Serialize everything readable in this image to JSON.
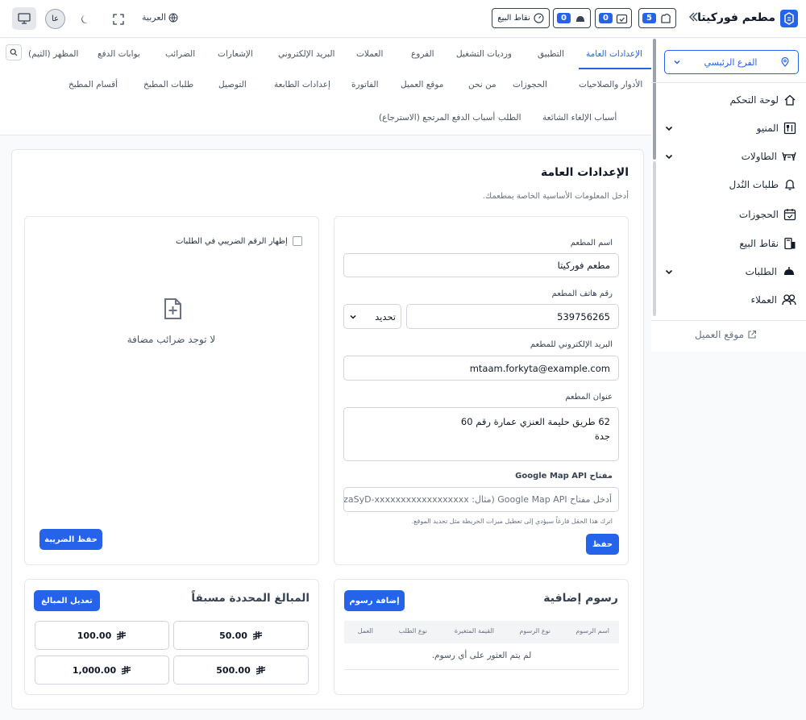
{
  "header": {
    "brand": "مطعم فوركيتا",
    "pos_label": "نقاط البيع",
    "counters": [
      {
        "name": "orders",
        "value": "5"
      },
      {
        "name": "reservations",
        "value": "0"
      },
      {
        "name": "waiter-calls",
        "value": "0"
      },
      {
        "name": "service",
        "value": "0"
      }
    ],
    "language": "العربية",
    "avatar_initials": "عا"
  },
  "sidebar": {
    "branch": "الفرع الرئيسي",
    "items": [
      {
        "label": "لوحة التحكم",
        "icon": "home-icon",
        "has_children": false
      },
      {
        "label": "المنيو",
        "icon": "menu-icon",
        "has_children": true
      },
      {
        "label": "الطاولات",
        "icon": "table-icon",
        "has_children": true
      },
      {
        "label": "طلبات النُدل",
        "icon": "bell-icon",
        "has_children": false
      },
      {
        "label": "الحجوزات",
        "icon": "calendar-icon",
        "has_children": false
      },
      {
        "label": "نقاط البيع",
        "icon": "pos-icon",
        "has_children": false
      },
      {
        "label": "الطلبات",
        "icon": "cloche-icon",
        "has_children": true
      },
      {
        "label": "العملاء",
        "icon": "users-icon",
        "has_children": false
      }
    ],
    "customer_site": "موقع العميل"
  },
  "tabs": {
    "row1": [
      "الإعدادات العامة",
      "التطبيق",
      "ورديات التشغيل",
      "الفروع",
      "العملات",
      "البريد الإلكتروني",
      "الإشعارات",
      "الضرائب",
      "بوابات الدفع",
      "المظهر (الثيم)"
    ],
    "row2": [
      "الأدوار والصلاحيات",
      "الحجوزات",
      "من نحن",
      "موقع العميل",
      "الفاتورة",
      "إعدادات الطابعة",
      "التوصيل",
      "طلبات المطبخ",
      "أقسام المطبخ"
    ],
    "row3": [
      "أسباب الإلغاء الشائعة",
      "الطلب",
      "أسباب الدفع المرتجع (الاسترجاع)"
    ],
    "active": "الإعدادات العامة"
  },
  "general": {
    "title": "الإعدادات العامة",
    "subtitle": "أدخل المعلومات الأساسية الخاصة بمطعمك.",
    "name_label": "اسم المطعم",
    "name_value": "مطعم فوركيتا",
    "phone_label": "رقم هاتف المطعم",
    "phone_value": "539756265",
    "country_select": "تحديد",
    "email_label": "البريد الإلكتروني للمطعم",
    "email_value": "mtaam.forkyta@example.com",
    "address_label": "عنوان المطعم",
    "address_line1": "62 طريق حليمة العنزي عمارة رقم 60",
    "address_line2": "جدة",
    "map_label": "مفتاح Google Map API",
    "map_placeholder": "أدخل مفتاح Google Map API (مثال: AIzaSyD-xxxxxxxxxxxxxxxxxx)",
    "map_hint": "اترك هذا الحقل فارغاً سيؤدي إلى تعطيل ميزات الخريطة مثل تحديد الموقع.",
    "save": "حفظ"
  },
  "tax": {
    "checkbox_label": "إظهار الرقم الضريبي في الطلبات",
    "empty": "لا توجد ضرائب مضافة",
    "save": "حفظ الضريبة"
  },
  "fees": {
    "title": "رسوم إضافية",
    "add": "إضافة رسوم",
    "columns": [
      "اسم الرسوم",
      "نوع الرسوم",
      "القيمة المتغيرة",
      "نوع الطلب",
      "العمل"
    ],
    "empty": "لم يتم العثور على أي رسوم."
  },
  "preset": {
    "title": "المبالغ المحددة مسبقاً",
    "edit": "تعديل المبالغ",
    "amounts": [
      "50.00",
      "100.00",
      "500.00",
      "1,000.00"
    ],
    "currency_icon": "riyal-icon"
  },
  "colors": {
    "primary": "#2563eb"
  }
}
